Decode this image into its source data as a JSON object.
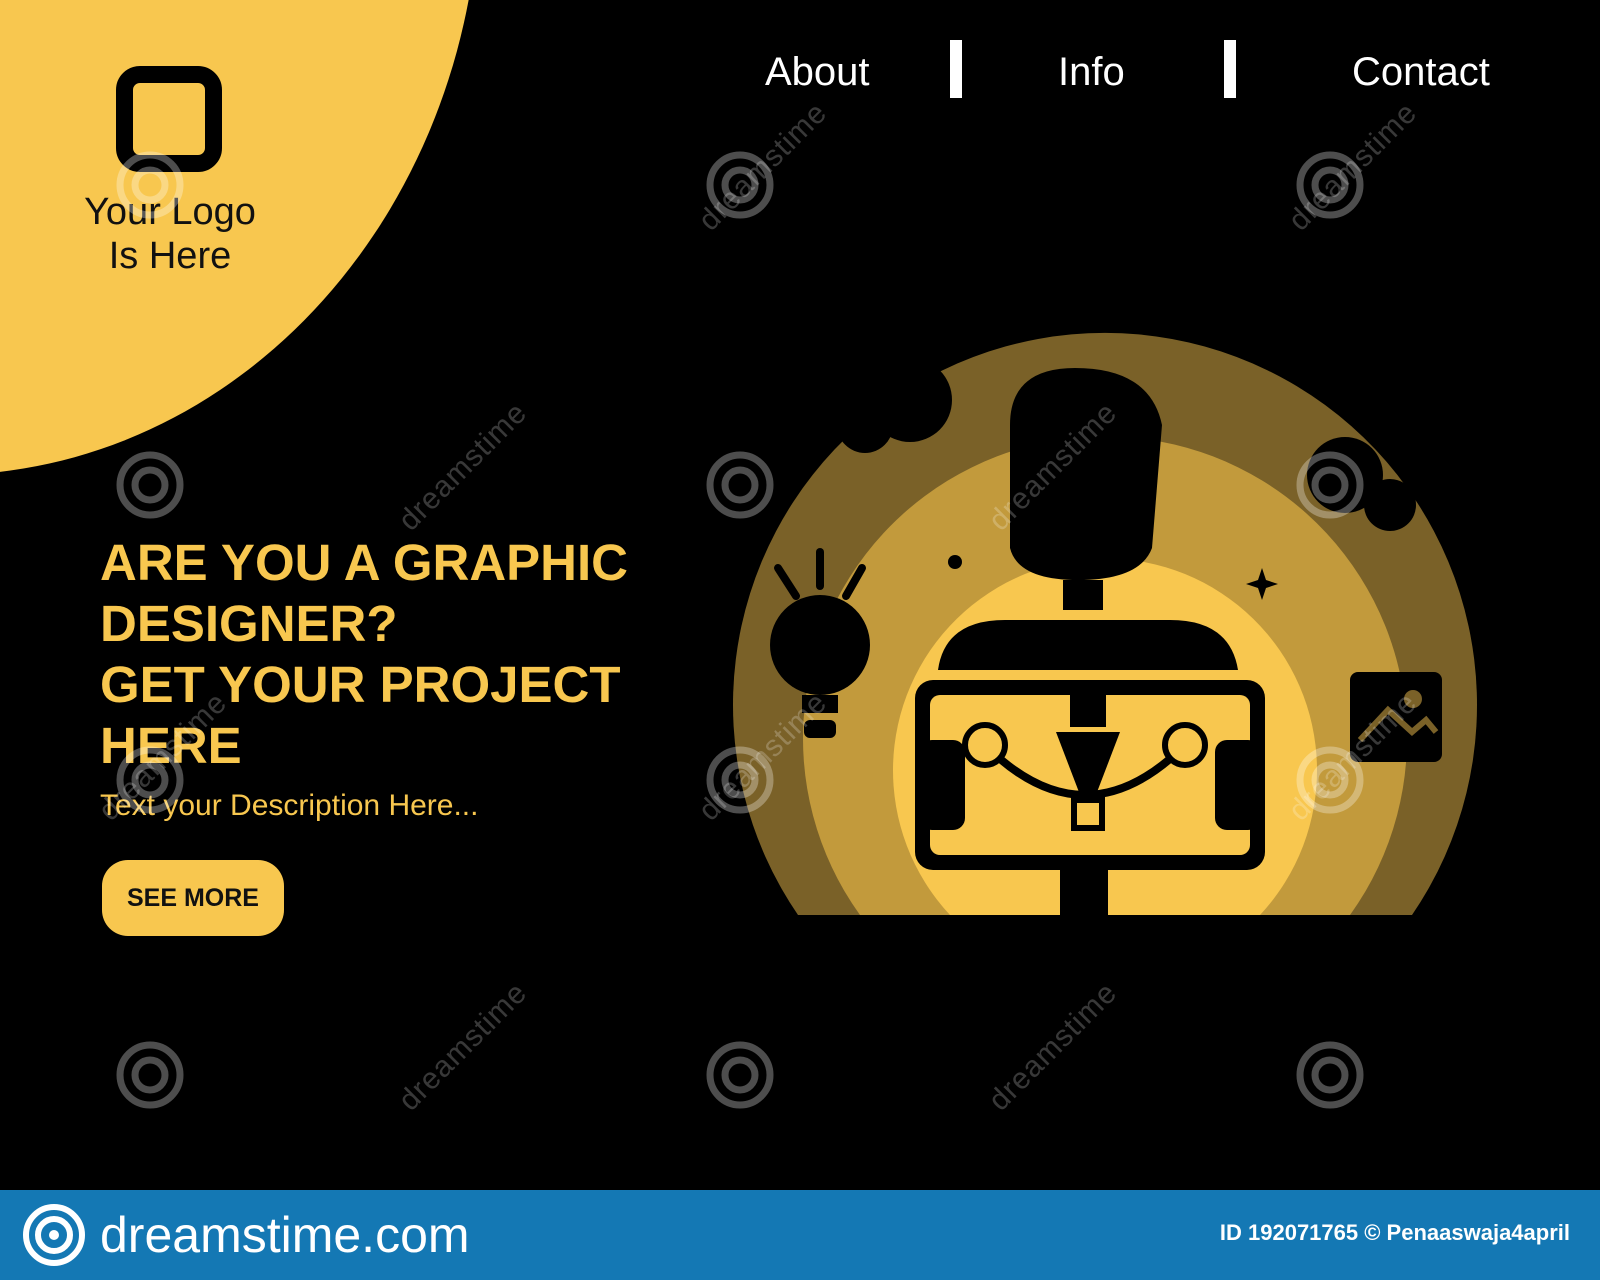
{
  "colors": {
    "accent": "#f8c74f",
    "accent_mid": "#c29a3c",
    "accent_dark": "#7a6128",
    "background": "#000000",
    "footer": "#1478b4"
  },
  "logo": {
    "line1": "Your Logo",
    "line2": "Is Here",
    "icon": "rounded-square-logo-icon"
  },
  "nav": {
    "items": [
      "About",
      "Info",
      "Contact"
    ]
  },
  "hero": {
    "headline_lines": [
      "ARE YOU A GRAPHIC",
      "DESIGNER?",
      "GET YOUR PROJECT",
      "HERE"
    ],
    "description": "Text your Description Here...",
    "button_label": "SEE MORE"
  },
  "illustration": {
    "icons": [
      "designer-person-icon",
      "lightbulb-icon",
      "image-icon",
      "pen-tool-icon",
      "sparkle-icon"
    ]
  },
  "watermark": {
    "text": "dreamstime"
  },
  "footer": {
    "brand": "dreamstime.com",
    "credit": "ID 192071765 © Penaaswaja4april"
  }
}
